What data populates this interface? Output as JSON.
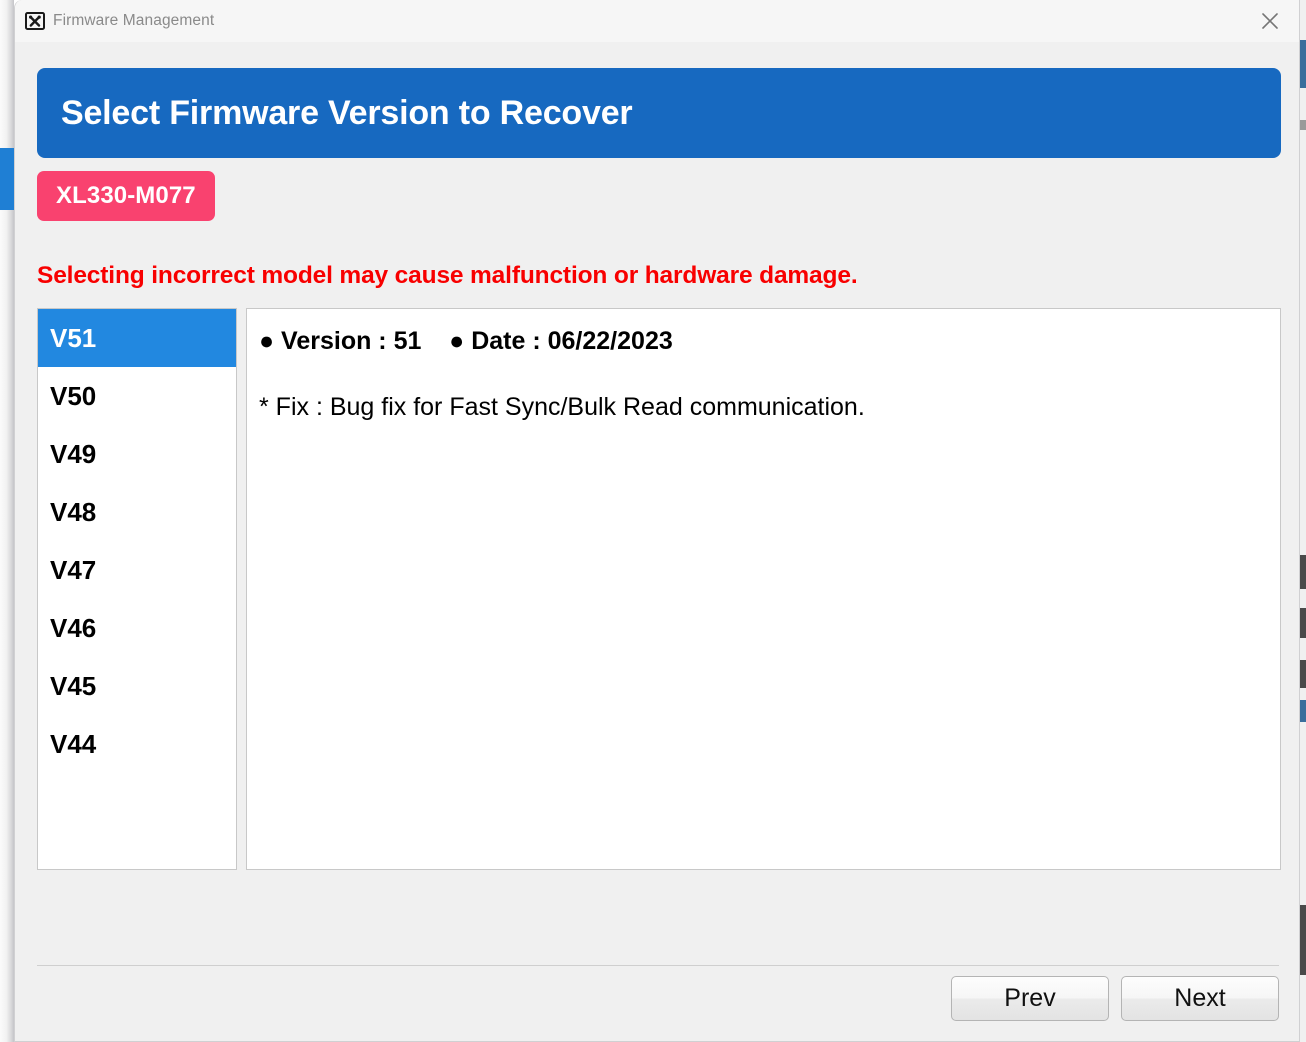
{
  "window": {
    "titlebar": {
      "icon": "firmware-tools-icon",
      "title": "Firmware Management",
      "close_label": "close-icon"
    }
  },
  "banner": {
    "title": "Select Firmware Version to Recover",
    "color": "#1769c0"
  },
  "model_badge": {
    "label": "XL330-M077",
    "color": "#f9426f"
  },
  "warning": {
    "text": "Selecting incorrect model may cause malfunction or hardware damage.",
    "color": "#f80000"
  },
  "version_list": {
    "selected": "V51",
    "selected_color": "#2288e0",
    "items": [
      {
        "label": "V51",
        "selected": true
      },
      {
        "label": "V50",
        "selected": false
      },
      {
        "label": "V49",
        "selected": false
      },
      {
        "label": "V48",
        "selected": false
      },
      {
        "label": "V47",
        "selected": false
      },
      {
        "label": "V46",
        "selected": false
      },
      {
        "label": "V45",
        "selected": false
      },
      {
        "label": "V44",
        "selected": false
      }
    ]
  },
  "detail": {
    "header": "● Version : 51    ● Date : 06/22/2023",
    "version_label": "Version",
    "version_value": "51",
    "date_label": "Date",
    "date_value": "06/22/2023",
    "body": "* Fix : Bug fix for Fast Sync/Bulk Read communication."
  },
  "footer": {
    "prev_label": "Prev",
    "next_label": "Next"
  }
}
